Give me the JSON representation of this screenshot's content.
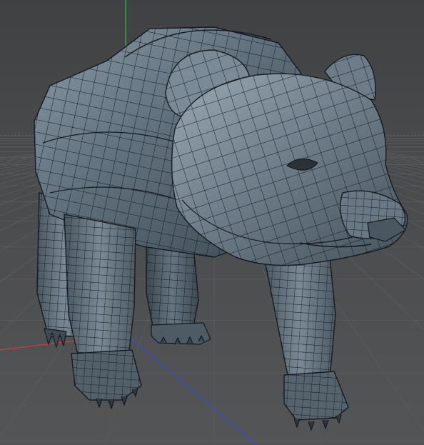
{
  "viewport": {
    "view": "perspective",
    "background_color": "#4a4b4d",
    "grid_color": "#5b5c5e",
    "horizon_color": "#6a6b6d",
    "axis_colors": {
      "x": "#d23a3a",
      "y": "#2fbf3a",
      "z": "#3a4ad8"
    }
  },
  "model": {
    "subject": "bear",
    "shading": "gouraud-lines",
    "surface_color": "#5d6c78",
    "wire_color": "#141a20"
  }
}
